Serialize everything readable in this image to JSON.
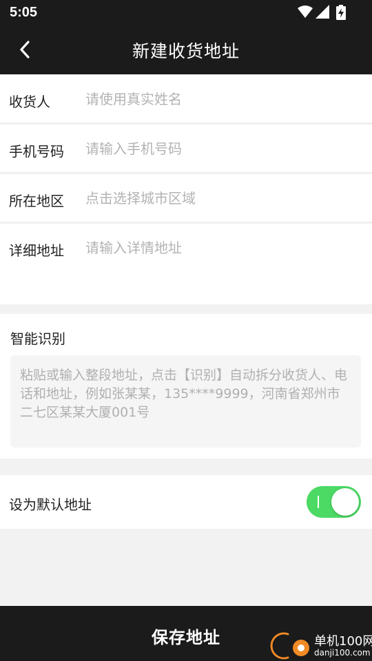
{
  "status_bar": {
    "time": "5:05",
    "icons": [
      "wifi-icon",
      "signal-icon",
      "battery-charging-icon"
    ]
  },
  "header": {
    "title": "新建收货地址",
    "back_icon": "chevron-left-icon"
  },
  "form": {
    "recipient": {
      "label": "收货人",
      "placeholder": "请使用真实姓名"
    },
    "phone": {
      "label": "手机号码",
      "placeholder": "请输入手机号码"
    },
    "region": {
      "label": "所在地区",
      "placeholder": "点击选择城市区域"
    },
    "detail": {
      "label": "详细地址",
      "placeholder": "请输入详情地址"
    }
  },
  "smart_recognition": {
    "title": "智能识别",
    "placeholder": "粘贴或输入整段地址，点击【识别】自动拆分收货人、电话和地址，例如张某某，135****9999，河南省郑州市二七区某某大厦001号"
  },
  "default_address": {
    "label": "设为默认地址",
    "enabled": true,
    "toggle_color": "#4cd964"
  },
  "footer": {
    "save_label": "保存地址"
  },
  "watermark": {
    "name": "单机100网",
    "url": "danji100.com"
  },
  "colors": {
    "bar_background": "#1b1b1b",
    "page_background": "#f2f2f2",
    "placeholder": "#b3b3b3"
  }
}
